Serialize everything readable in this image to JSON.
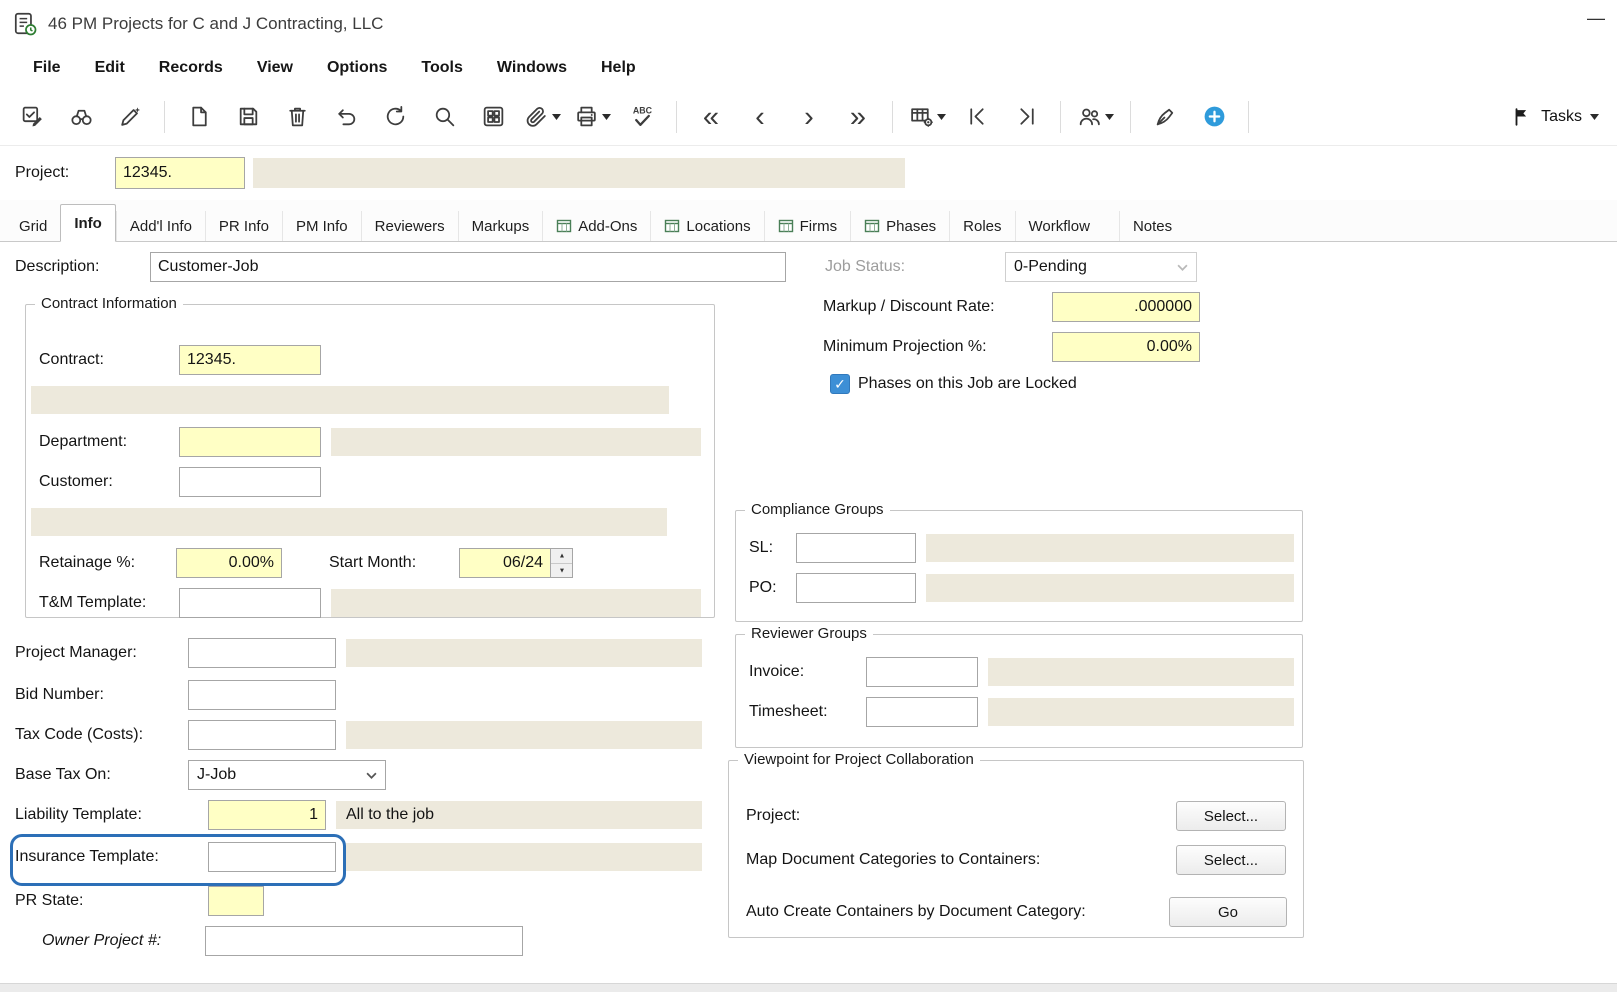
{
  "window": {
    "title": "46 PM Projects for C and J Contracting, LLC",
    "minimize_glyph": "—"
  },
  "menu_items": [
    "File",
    "Edit",
    "Records",
    "View",
    "Options",
    "Tools",
    "Windows",
    "Help"
  ],
  "toolbar": {
    "spell_label": "ABC",
    "nav_first": "«",
    "nav_prev": "‹",
    "nav_next": "›",
    "nav_last": "»",
    "tasks_label": "Tasks"
  },
  "project_bar": {
    "label": "Project:",
    "value": "12345."
  },
  "tabs": [
    "Grid",
    "Info",
    "Add'l Info",
    "PR Info",
    "PM Info",
    "Reviewers",
    "Markups",
    "Add-Ons",
    "Locations",
    "Firms",
    "Phases",
    "Roles",
    "Workflow",
    "Notes"
  ],
  "form": {
    "description": {
      "label": "Description:",
      "value": "Customer-Job"
    },
    "job_status": {
      "label": "Job Status:",
      "value": "0-Pending"
    },
    "markup_rate": {
      "label": "Markup / Discount Rate:",
      "value": ".000000"
    },
    "min_projection": {
      "label": "Minimum Projection %:",
      "value": "0.00%"
    },
    "phases_locked": {
      "label": "Phases on this Job are Locked",
      "checked": true
    },
    "contract_info": {
      "legend": "Contract Information",
      "contract": {
        "label": "Contract:",
        "value": "12345."
      },
      "department": {
        "label": "Department:",
        "value": ""
      },
      "customer": {
        "label": "Customer:",
        "value": ""
      },
      "retainage": {
        "label": "Retainage %:",
        "value": "0.00%"
      },
      "start_month": {
        "label": "Start Month:",
        "value": "06/24"
      },
      "tm_template": {
        "label": "T&M Template:",
        "value": ""
      }
    },
    "project_manager": {
      "label": "Project Manager:",
      "value": ""
    },
    "bid_number": {
      "label": "Bid Number:",
      "value": ""
    },
    "tax_code": {
      "label": "Tax Code (Costs):",
      "value": ""
    },
    "base_tax_on": {
      "label": "Base Tax On:",
      "value": "J-Job"
    },
    "liability_template": {
      "label": "Liability Template:",
      "value": "1",
      "description": "All to the job"
    },
    "insurance_template": {
      "label": "Insurance Template:",
      "value": ""
    },
    "pr_state": {
      "label": "PR State:",
      "value": ""
    },
    "owner_project": {
      "label": "Owner Project #:",
      "value": ""
    },
    "compliance_groups": {
      "legend": "Compliance Groups",
      "sl": {
        "label": "SL:",
        "value": ""
      },
      "po": {
        "label": "PO:",
        "value": ""
      }
    },
    "reviewer_groups": {
      "legend": "Reviewer Groups",
      "invoice": {
        "label": "Invoice:",
        "value": ""
      },
      "timesheet": {
        "label": "Timesheet:",
        "value": ""
      }
    },
    "viewpoint": {
      "legend": "Viewpoint for Project Collaboration",
      "project": {
        "label": "Project:",
        "button": "Select..."
      },
      "map_categories": {
        "label": "Map Document Categories to Containers:",
        "button": "Select..."
      },
      "auto_create": {
        "label": "Auto Create Containers by Document Category:",
        "button": "Go"
      }
    }
  },
  "colors": {
    "field_yellow": "#FFFFC5",
    "field_readonly": "#EDE9DC",
    "focus_ring": "#2C6FB7",
    "checkbox_blue": "#3D8FD6",
    "add_button_blue": "#2F9BDB"
  }
}
